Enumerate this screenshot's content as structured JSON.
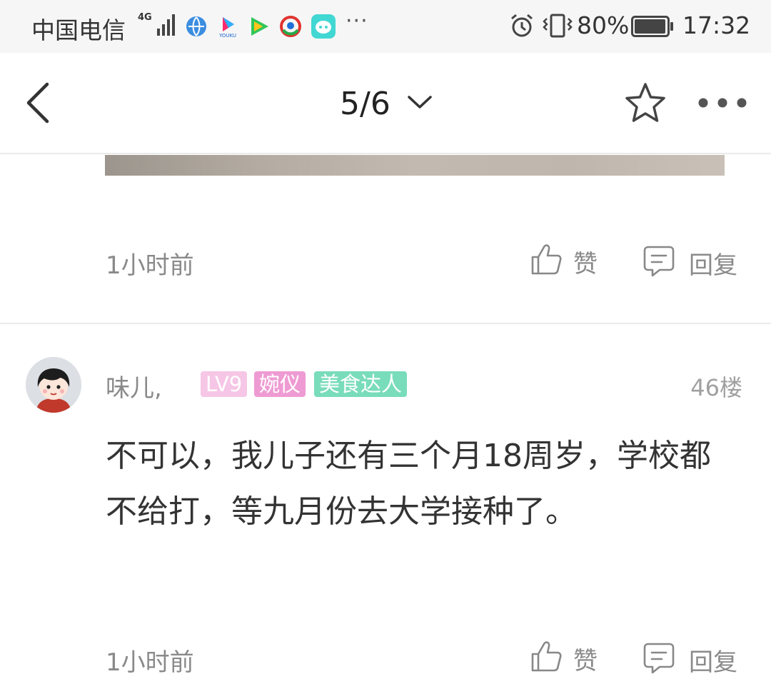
{
  "status_bar": {
    "carrier": "中国电信",
    "network": "4G",
    "app_icons": [
      "browser-app-icon",
      "youku-app-icon",
      "video-app-icon",
      "news-app-icon",
      "chat-app-icon"
    ],
    "more": "···",
    "battery_percent": "80%",
    "battery_level": 0.8,
    "time": "17:32"
  },
  "nav": {
    "page_indicator": "5/6"
  },
  "comments": [
    {
      "time": "1小时前",
      "like_label": "赞",
      "reply_label": "回复"
    },
    {
      "username": "味儿,",
      "badges": [
        "LV9",
        "婉仪",
        "美食达人"
      ],
      "floor": "46楼",
      "text": "不可以，我儿子还有三个月18周岁，学校都不给打，等九月份去大学接种了。",
      "time": "1小时前",
      "like_label": "赞",
      "reply_label": "回复"
    }
  ],
  "colors": {
    "badge_lv": "#f6c6e6",
    "badge_role": "#ef9bd3",
    "badge_title": "#79dcbb",
    "meta_text": "#8a8a8a"
  }
}
